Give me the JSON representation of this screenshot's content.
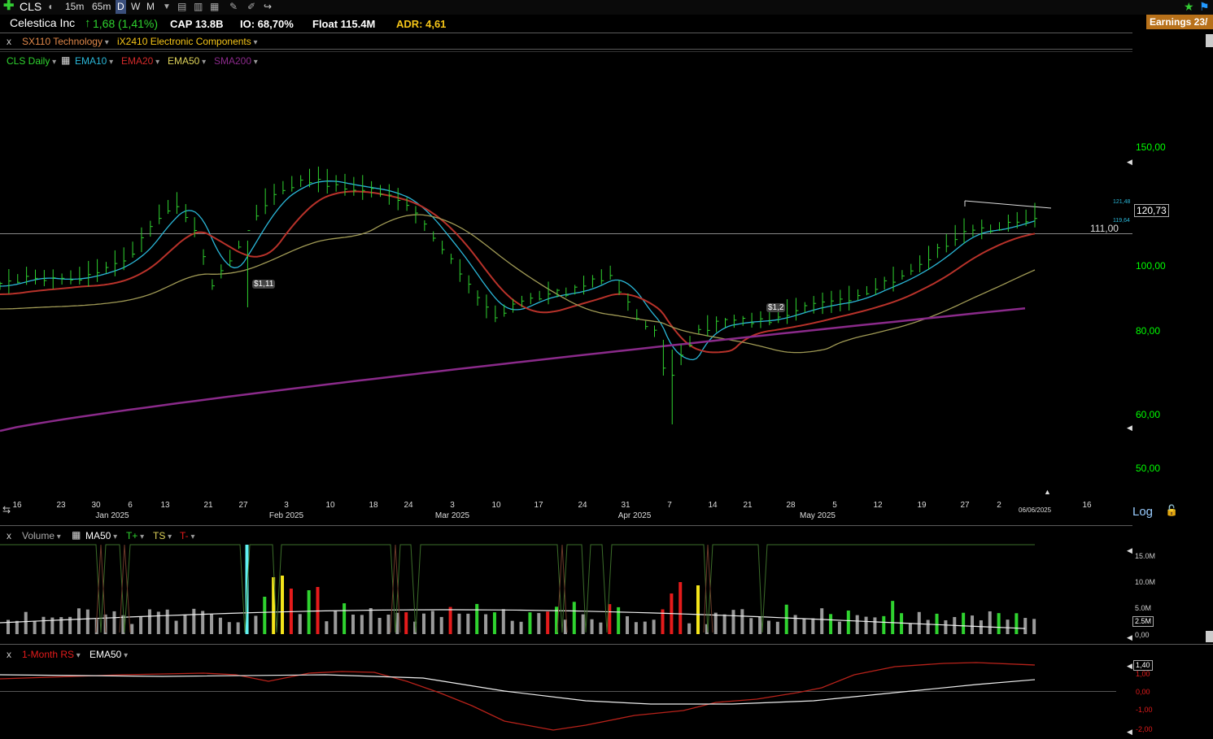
{
  "toolbar": {
    "symbol": "CLS",
    "intervals": [
      "15m",
      "65m",
      "D",
      "W",
      "M"
    ],
    "active_interval": "D",
    "earnings_badge": "Earnings 23/"
  },
  "info": {
    "company": "Celestica Inc",
    "change": "1,68",
    "change_pct": "(1,41%)",
    "cap": "CAP 13.8B",
    "io": "IO: 68,70%",
    "float": "Float 115.4M",
    "adr": "ADR: 4,61"
  },
  "industry": {
    "close": "x",
    "sector": "SX110 Technology",
    "group": "iX2410 Electronic Components"
  },
  "price_legend": {
    "symbol_label": "CLS Daily",
    "items": [
      {
        "label": "EMA10",
        "color": "#2ab7d8"
      },
      {
        "label": "EMA20",
        "color": "#d22a2a"
      },
      {
        "label": "EMA50",
        "color": "#dfd35a"
      },
      {
        "label": "SMA200",
        "color": "#8a2a8a"
      }
    ]
  },
  "price_axis": {
    "ticks": [
      "150,00",
      "100,00",
      "80,00",
      "60,00",
      "50,00"
    ],
    "last_price": "120,73",
    "hline_label": "111,00",
    "ema10_tag": "121,48",
    "ema20_tag": "119,64",
    "scale_mode": "Log"
  },
  "earnings_markers": [
    "$1,11",
    "$1,2"
  ],
  "date_axis": {
    "days": [
      "16",
      "23",
      "30",
      "6",
      "13",
      "21",
      "27",
      "3",
      "10",
      "18",
      "24",
      "3",
      "10",
      "17",
      "24",
      "31",
      "7",
      "14",
      "21",
      "28",
      "5",
      "12",
      "19",
      "27",
      "2",
      "16"
    ],
    "months": [
      "Jan 2025",
      "Feb 2025",
      "Mar 2025",
      "Apr 2025",
      "May 2025"
    ],
    "current_date": "06/06/2025"
  },
  "volume_legend": {
    "close": "x",
    "title": "Volume",
    "ma": "MA50",
    "tplus": "T+",
    "ts": "TS",
    "tminus": "T-"
  },
  "volume_axis": {
    "ticks": [
      "15.0M",
      "10.0M",
      "5.0M",
      "0,00"
    ],
    "current": "2.5M"
  },
  "rs_legend": {
    "close": "x",
    "title": "1-Month RS",
    "ema": "EMA50"
  },
  "rs_axis": {
    "current": "1,40",
    "ticks": [
      "1,00",
      "0,00",
      "-1,00",
      "-2,00"
    ]
  },
  "colors": {
    "up": "#2fd32f",
    "down": "#e51b1b",
    "neutral": "#9a9a9a",
    "accent_yellow": "#f5e51a",
    "accent_cyan": "#5ff0f0",
    "hline": "#888888"
  }
}
